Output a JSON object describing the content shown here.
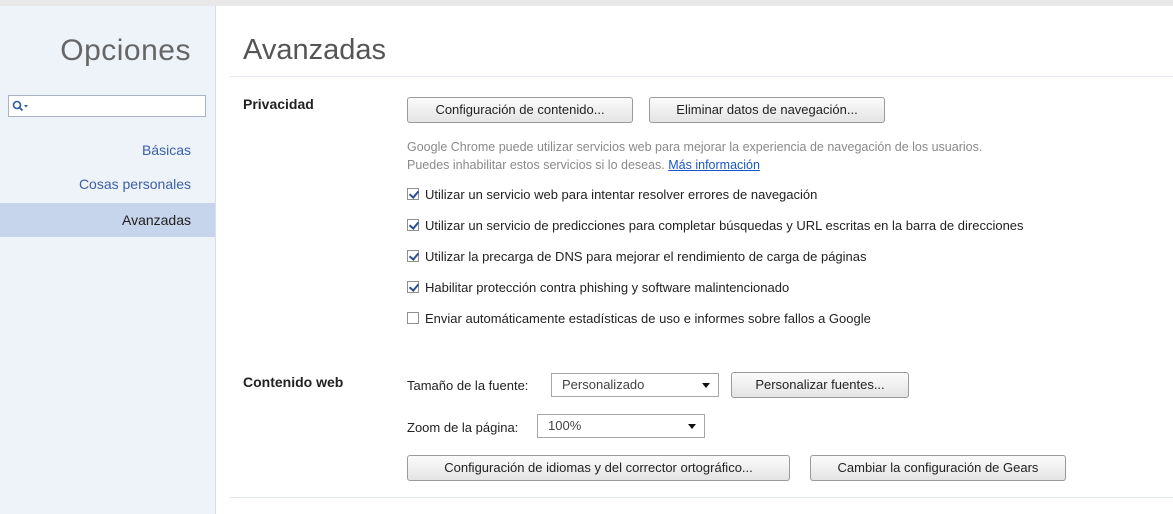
{
  "sidebar": {
    "title": "Opciones",
    "search_placeholder": "",
    "items": [
      {
        "label": "Básicas",
        "selected": false
      },
      {
        "label": "Cosas personales",
        "selected": false
      },
      {
        "label": "Avanzadas",
        "selected": true
      }
    ]
  },
  "main": {
    "title": "Avanzadas",
    "privacy": {
      "label": "Privacidad",
      "content_settings_button": "Configuración de contenido...",
      "clear_data_button": "Eliminar datos de navegación...",
      "description_line1": "Google Chrome puede utilizar servicios web para mejorar la experiencia de navegación de los usuarios.",
      "description_line2": "Puedes inhabilitar estos servicios si lo deseas.",
      "more_info_link": "Más información",
      "options": [
        {
          "label": "Utilizar un servicio web para intentar resolver errores de navegación",
          "checked": true
        },
        {
          "label": "Utilizar un servicio de predicciones para completar búsquedas y URL escritas en la barra de direcciones",
          "checked": true
        },
        {
          "label": "Utilizar la precarga de DNS para mejorar el rendimiento de carga de páginas",
          "checked": true
        },
        {
          "label": "Habilitar protección contra phishing y software malintencionado",
          "checked": true
        },
        {
          "label": "Enviar automáticamente estadísticas de uso e informes sobre fallos a Google",
          "checked": false
        }
      ]
    },
    "web_content": {
      "label": "Contenido web",
      "font_size_label": "Tamaño de la fuente:",
      "font_size_value": "Personalizado",
      "customize_fonts_button": "Personalizar fuentes...",
      "zoom_label": "Zoom de la página:",
      "zoom_value": "100%",
      "languages_button": "Configuración de idiomas y del corrector ortográfico...",
      "gears_button": "Cambiar la configuración de Gears"
    }
  },
  "colors": {
    "sidebar_bg": "#eef2f9",
    "selected_bg": "#c6d4ec",
    "link": "#3b5fa8"
  }
}
